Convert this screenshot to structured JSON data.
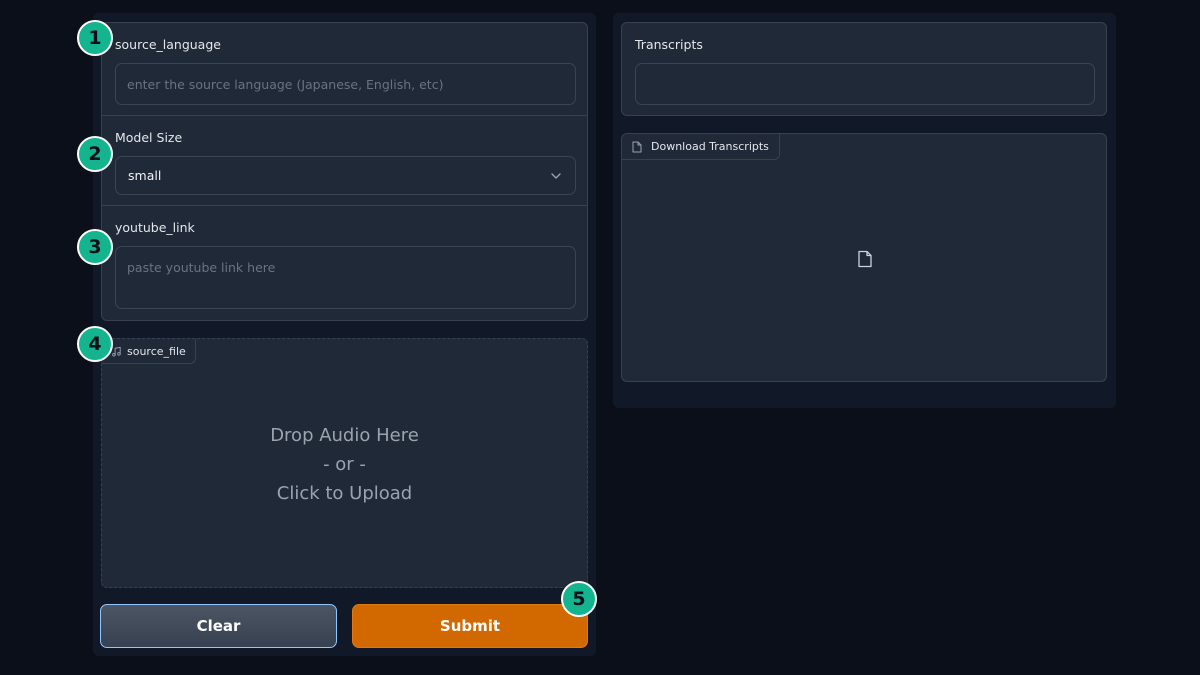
{
  "form": {
    "source_language": {
      "label": "source_language",
      "placeholder": "enter the source language (Japanese, English, etc)",
      "value": ""
    },
    "model_size": {
      "label": "Model Size",
      "selected": "small"
    },
    "youtube_link": {
      "label": "youtube_link",
      "placeholder": "paste youtube link here",
      "value": ""
    }
  },
  "upload": {
    "tab_label": "source_file",
    "tab_icon": "music-note-icon",
    "drop_line1": "Drop Audio Here",
    "drop_line2": "- or -",
    "drop_line3": "Click to Upload"
  },
  "buttons": {
    "clear_label": "Clear",
    "submit_label": "Submit"
  },
  "output": {
    "transcripts": {
      "label": "Transcripts",
      "value": ""
    },
    "download": {
      "tab_label": "Download Transcripts",
      "tab_icon": "file-icon",
      "empty_icon": "file-icon"
    }
  },
  "markers": [
    "1",
    "2",
    "3",
    "4",
    "5"
  ],
  "colors": {
    "background": "#0b0f19",
    "panel": "#111827",
    "block": "#1f2937",
    "border": "#374151",
    "submit": "#d26900",
    "marker": "#14b48f"
  }
}
